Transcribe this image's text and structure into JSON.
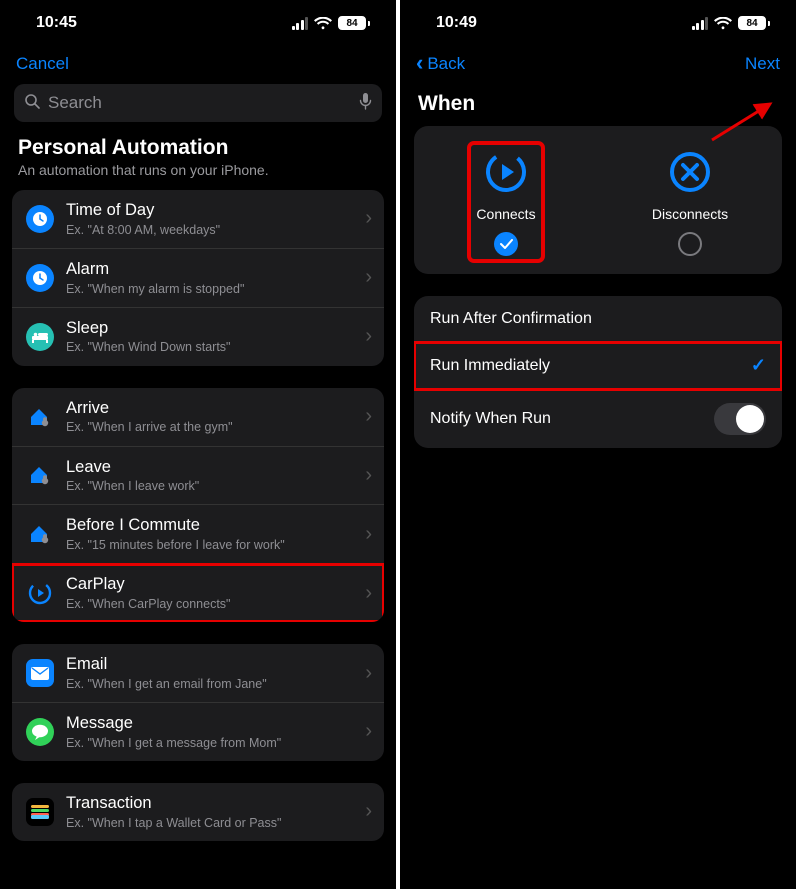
{
  "colors": {
    "accent": "#0a84ff",
    "highlight": "#e60000"
  },
  "left": {
    "status": {
      "time": "10:45",
      "battery": "84"
    },
    "nav": {
      "cancel": "Cancel"
    },
    "search": {
      "placeholder": "Search"
    },
    "header": {
      "title": "Personal Automation",
      "subtitle": "An automation that runs on your iPhone."
    },
    "groups": [
      {
        "rows": [
          {
            "id": "time-of-day",
            "icon": "clock",
            "title": "Time of Day",
            "sub": "Ex. \"At 8:00 AM, weekdays\""
          },
          {
            "id": "alarm",
            "icon": "clock",
            "title": "Alarm",
            "sub": "Ex. \"When my alarm is stopped\""
          },
          {
            "id": "sleep",
            "icon": "bed",
            "title": "Sleep",
            "sub": "Ex. \"When Wind Down starts\""
          }
        ]
      },
      {
        "rows": [
          {
            "id": "arrive",
            "icon": "home-arrive",
            "title": "Arrive",
            "sub": "Ex. \"When I arrive at the gym\""
          },
          {
            "id": "leave",
            "icon": "home-leave",
            "title": "Leave",
            "sub": "Ex. \"When I leave work\""
          },
          {
            "id": "before-commute",
            "icon": "home-clock",
            "title": "Before I Commute",
            "sub": "Ex. \"15 minutes before I leave for work\""
          },
          {
            "id": "carplay",
            "icon": "carplay",
            "title": "CarPlay",
            "sub": "Ex. \"When CarPlay connects\"",
            "highlight": true
          }
        ]
      },
      {
        "rows": [
          {
            "id": "email",
            "icon": "mail",
            "title": "Email",
            "sub": "Ex. \"When I get an email from Jane\""
          },
          {
            "id": "message",
            "icon": "message",
            "title": "Message",
            "sub": "Ex. \"When I get a message from Mom\""
          }
        ]
      },
      {
        "rows": [
          {
            "id": "transaction",
            "icon": "wallet",
            "title": "Transaction",
            "sub": "Ex. \"When I tap a Wallet Card or Pass\""
          }
        ]
      }
    ]
  },
  "right": {
    "status": {
      "time": "10:49",
      "battery": "84"
    },
    "nav": {
      "back": "Back",
      "next": "Next"
    },
    "section_title": "When",
    "when_cards": [
      {
        "id": "connects",
        "label": "Connects",
        "selected": true,
        "highlight": true
      },
      {
        "id": "disconnects",
        "label": "Disconnects",
        "selected": false
      }
    ],
    "options": [
      {
        "id": "run-confirm",
        "label": "Run After Confirmation",
        "type": "radio",
        "selected": false
      },
      {
        "id": "run-immediate",
        "label": "Run Immediately",
        "type": "radio",
        "selected": true,
        "highlight": true
      },
      {
        "id": "notify",
        "label": "Notify When Run",
        "type": "toggle",
        "on": false
      }
    ]
  }
}
